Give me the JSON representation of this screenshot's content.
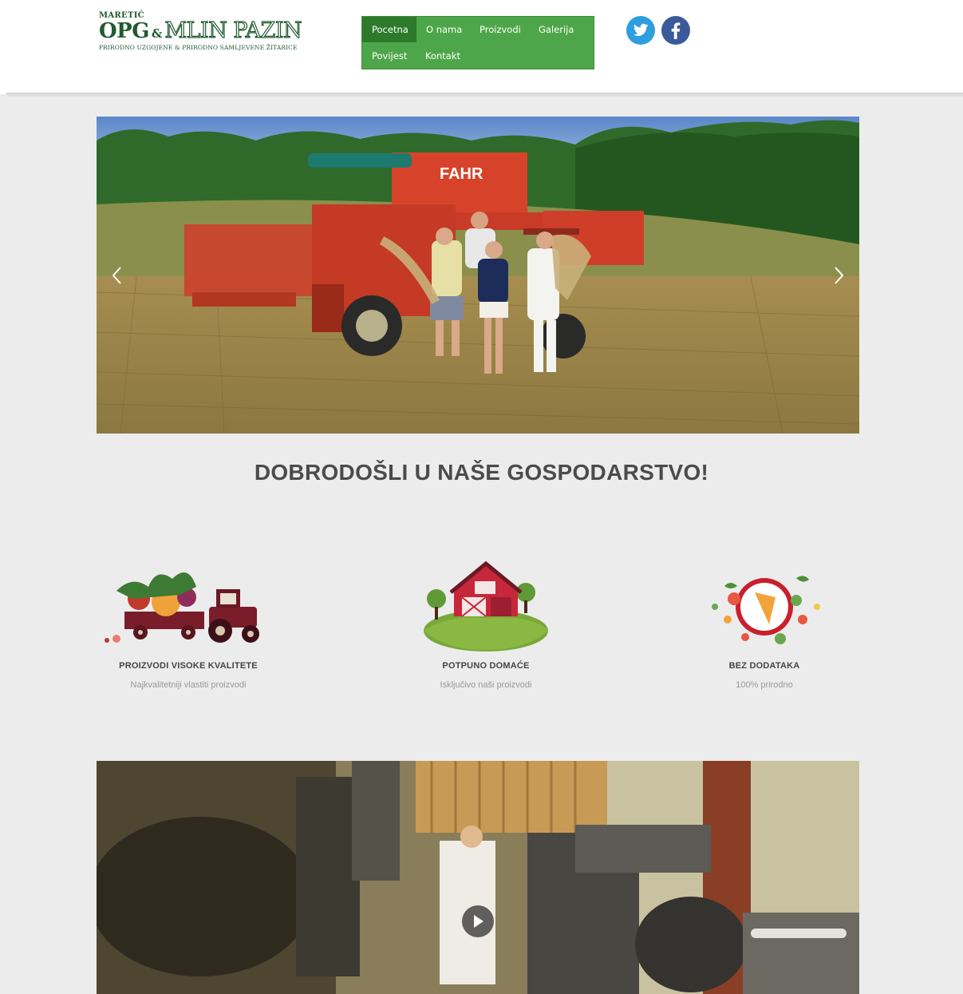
{
  "logo": {
    "top_text": "MARETIĆ",
    "opg": "OPG",
    "amp": "&",
    "mlin": "MLIN PAZIN",
    "subtitle": "PRIRODNO UZGOJENE & PRIRODNO SAMLJEVENE ŽITARICE"
  },
  "nav": {
    "items": [
      {
        "label": "Pocetna",
        "active": true
      },
      {
        "label": "O nama"
      },
      {
        "label": "Proizvodi"
      },
      {
        "label": "Galerija"
      },
      {
        "label": "Povijest"
      },
      {
        "label": "Kontakt"
      }
    ],
    "color": "#4ea64a",
    "active_color": "#2d7a2b"
  },
  "social": [
    "twitter-icon",
    "facebook-icon"
  ],
  "slider": {
    "image_text": "FAHR",
    "prev_icon": "chevron-left-icon",
    "next_icon": "chevron-right-icon"
  },
  "welcome": "DOBRODOŠLI U NAŠE GOSPODARSTVO!",
  "features": [
    {
      "title": "PROIZVODI VISOKE KVALITETE",
      "desc": "Najkvalitetniji vlastiti proizvodi",
      "icon": "tractor-icon"
    },
    {
      "title": "POTPUNO DOMAĆE",
      "desc": "Isključivo naši proizvodi",
      "icon": "barn-icon"
    },
    {
      "title": "BEZ DODATAKA",
      "desc": "100% prirodno",
      "icon": "plate-icon"
    }
  ],
  "video": {
    "play_icon": "play-icon"
  }
}
